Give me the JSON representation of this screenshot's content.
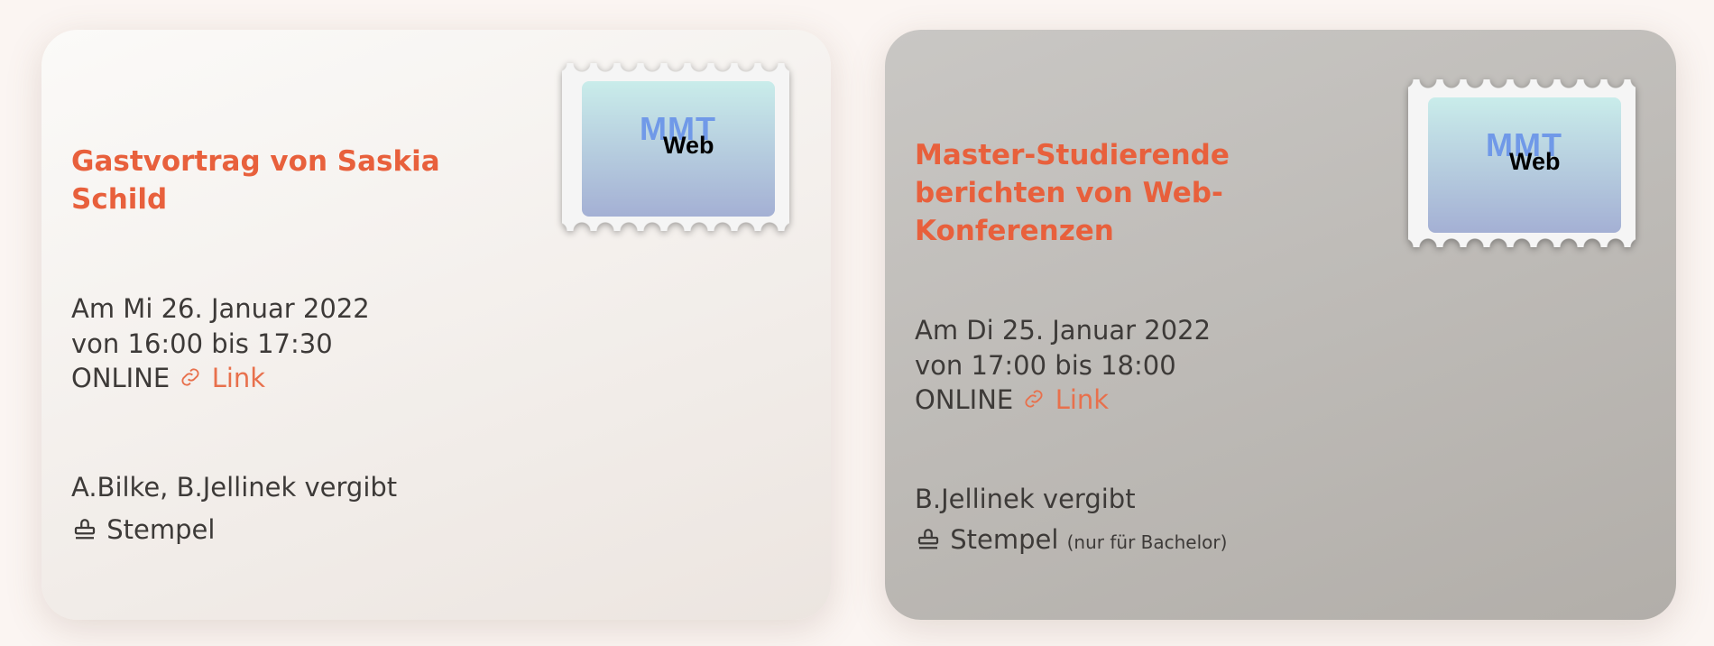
{
  "events": [
    {
      "title": "Gastvortrag von Saskia Schild",
      "date": "Am Mi 26. Januar 2022",
      "time": "von 16:00 bis 17:30",
      "location": "ONLINE",
      "link_label": "Link",
      "organizer": "A.Bilke, B.Jellinek vergibt",
      "stamp_label": "Stempel",
      "stamp_note": "",
      "logo_top": "MMT",
      "logo_bottom": "Web"
    },
    {
      "title": "Master-Studierende berichten von Web-Konferenzen",
      "date": "Am Di 25. Januar 2022",
      "time": "von 17:00 bis 18:00",
      "location": "ONLINE",
      "link_label": "Link",
      "organizer": "B.Jellinek vergibt",
      "stamp_label": "Stempel",
      "stamp_note": "(nur für Bachelor)",
      "logo_top": "MMT",
      "logo_bottom": "Web"
    }
  ],
  "colors": {
    "accent": "#e8603c",
    "card_active": "#f6f3f0",
    "card_inactive": "#bfbcb8"
  }
}
